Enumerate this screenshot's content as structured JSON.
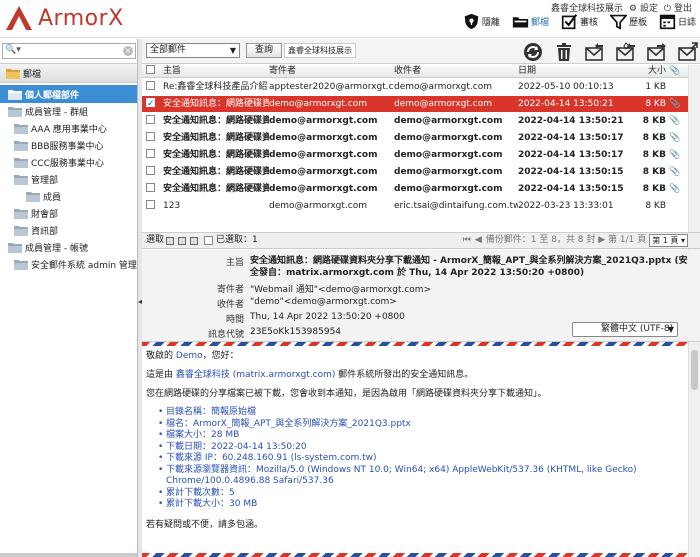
{
  "app": {
    "brand": "ArmorX",
    "user": "鑫睿全球科技展示",
    "settings_label": "設定",
    "logout_label": "登出"
  },
  "nav": [
    {
      "label": "隱離",
      "icon": "shield-icon"
    },
    {
      "label": "郵檔",
      "icon": "folder-icon"
    },
    {
      "label": "審核",
      "icon": "checklist-icon"
    },
    {
      "label": "歷板",
      "icon": "funnel-icon"
    },
    {
      "label": "日誌",
      "icon": "calendar-icon"
    }
  ],
  "sidebar": {
    "search_placeholder": "",
    "folder_header": "郵檔",
    "tree": [
      {
        "label": "個人郵檔部件",
        "level": 0,
        "selected": true
      },
      {
        "label": "成員管理 - 群組",
        "level": 0
      },
      {
        "label": "AAA 應用事業中心",
        "level": 1
      },
      {
        "label": "BBB服務事業中心",
        "level": 1
      },
      {
        "label": "CCC服務事業中心",
        "level": 1
      },
      {
        "label": "管理部",
        "level": 1
      },
      {
        "label": "成員",
        "level": 2
      },
      {
        "label": "財會部",
        "level": 1
      },
      {
        "label": "資訊部",
        "level": 1
      },
      {
        "label": "成員管理 - 帳號",
        "level": 0
      },
      {
        "label": "安全郵件系統 admin 管理",
        "level": 1
      }
    ]
  },
  "toolbar": {
    "filter_value": "全部郵件",
    "query_label": "查詢",
    "scope_label": "鑫睿全球科技展示"
  },
  "list": {
    "headers": {
      "subject": "主旨",
      "from": "寄件者",
      "to": "收件者",
      "date": "日期",
      "size": "大小"
    },
    "rows": [
      {
        "subject": "Re:鑫睿全球科技產品介紹",
        "from": "apptester2020@armorxgt.com",
        "to": "demo@armorxgt.com",
        "date": "2022-05-10 00:10:13",
        "size": "1 KB",
        "unread": false,
        "selected": false,
        "attach": false
      },
      {
        "subject": "安全通知訊息：網路硬碟資料夾分享",
        "from": "demo@armorxgt.com",
        "to": "demo@armorxgt.com",
        "date": "2022-04-14 13:50:21",
        "size": "8 KB",
        "unread": false,
        "selected": true,
        "attach": true
      },
      {
        "subject": "安全通知訊息：網路硬碟資料夾分享",
        "from": "demo@armorxgt.com",
        "to": "demo@armorxgt.com",
        "date": "2022-04-14 13:50:21",
        "size": "8 KB",
        "unread": true,
        "selected": false,
        "attach": true
      },
      {
        "subject": "安全通知訊息：網路硬碟資料夾分享",
        "from": "demo@armorxgt.com",
        "to": "demo@armorxgt.com",
        "date": "2022-04-14 13:50:17",
        "size": "8 KB",
        "unread": true,
        "selected": false,
        "attach": true
      },
      {
        "subject": "安全通知訊息：網路硬碟資料夾分享",
        "from": "demo@armorxgt.com",
        "to": "demo@armorxgt.com",
        "date": "2022-04-14 13:50:17",
        "size": "8 KB",
        "unread": true,
        "selected": false,
        "attach": true
      },
      {
        "subject": "安全通知訊息：網路硬碟資料夾分享",
        "from": "demo@armorxgt.com",
        "to": "demo@armorxgt.com",
        "date": "2022-04-14 13:50:15",
        "size": "8 KB",
        "unread": true,
        "selected": false,
        "attach": true
      },
      {
        "subject": "安全通知訊息：網路硬碟資料夾分享",
        "from": "demo@armorxgt.com",
        "to": "demo@armorxgt.com",
        "date": "2022-04-14 13:50:15",
        "size": "8 KB",
        "unread": true,
        "selected": false,
        "attach": true
      },
      {
        "subject": "123",
        "from": "demo@armorxgt.com",
        "to": "eric.tsai@dintaifung.com.tw",
        "date": "2022-03-23 13:33:01",
        "size": "8 KB",
        "unread": false,
        "selected": false,
        "attach": false
      }
    ]
  },
  "status": {
    "select_label": "選取",
    "selected_count": "已選取：1",
    "pager": "備份郵件：1 至 8，共 8 封 ▶ 第 1/1 頁",
    "page_select": "第 1 頁"
  },
  "preview": {
    "labels": {
      "subject": "主旨",
      "from": "寄件者",
      "to": "收件者",
      "time": "時間",
      "code": "訊息代號"
    },
    "subject": "安全通知訊息：網路硬碟資料夾分享下載通知 - ArmorX_簡報_APT_與全系列解決方案_2021Q3.pptx (安全發自：matrix.armorxgt.com 於 Thu, 14 Apr 2022 13:50:20 +0800)",
    "from": "\"Webmail 通知\"<demo@armorxgt.com>",
    "to": "\"demo\"<demo@armorxgt.com>",
    "time": "Thu, 14 Apr 2022 13:50:20 +0800",
    "code": "23E5oKk153985954",
    "encoding": "繁體中文 (UTF-8)",
    "body": {
      "greeting_pre": "敬啟的",
      "greeting_name": "Demo",
      "greeting_post": "，您好：",
      "line1_pre": "這是由",
      "line1_link": "鑫睿全球科技 (matrix.armorxgt.com)",
      "line1_post": "郵件系統所發出的安全通知訊息。",
      "line2": "您在網路硬碟的分享檔案已被下載，您會收到本通知，是因為啟用「網路硬碟資料夾分享下載通知」。",
      "details": [
        "目錄名稱：簡報原始檔",
        "檔名：ArmorX_簡報_APT_與全系列解決方案_2021Q3.pptx",
        "檔案大小：28 MB",
        "下載日期：2022-04-14 13:50:20",
        "下載來源 IP：60.248.160.91 (ls-system.com.tw)",
        "下載來源瀏覽器資訊：Mozilla/5.0 (Windows NT 10.0; Win64; x64) AppleWebKit/537.36 (KHTML, like Gecko) Chrome/100.0.4896.88 Safari/537.36",
        "累計下載次數：5",
        "累計下載大小：30 MB"
      ],
      "closing": "若有疑問或不便，請多包涵。"
    }
  }
}
